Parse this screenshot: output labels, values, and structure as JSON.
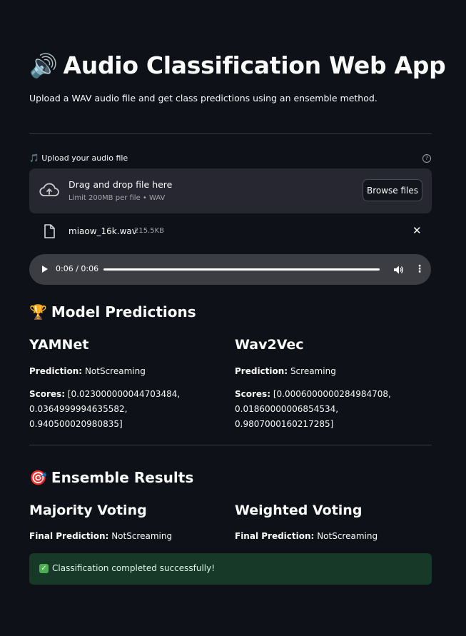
{
  "header": {
    "emoji": "🔊",
    "title": "Audio Classification Web App",
    "subtitle": "Upload a WAV audio file and get class predictions using an ensemble method."
  },
  "uploader": {
    "label": "🎵 Upload your audio file",
    "help_icon": "question-circle-icon",
    "drop_title": "Drag and drop file here",
    "limit_text": "Limit 200MB per file • WAV",
    "browse_label": "Browse files"
  },
  "uploaded_file": {
    "name": "miaow_16k.wav",
    "size": "215.5KB"
  },
  "audio_player": {
    "time": "0:06 / 0:06",
    "progress": 1.0
  },
  "predictions": {
    "heading": "Model Predictions",
    "emoji": "🏆",
    "models": [
      {
        "name": "YAMNet",
        "prediction_label": "Prediction:",
        "prediction": "NotScreaming",
        "scores_label": "Scores:",
        "scores": "[0.023000000044703484, 0.0364999994635582, 0.940500020980835]"
      },
      {
        "name": "Wav2Vec",
        "prediction_label": "Prediction:",
        "prediction": "Screaming",
        "scores_label": "Scores:",
        "scores": "[0.0006000000284984708, 0.01860000006854534, 0.9807000160217285]"
      }
    ]
  },
  "ensemble": {
    "heading": "Ensemble Results",
    "emoji": "🎯",
    "methods": [
      {
        "name": "Majority Voting",
        "label": "Final Prediction:",
        "value": "NotScreaming"
      },
      {
        "name": "Weighted Voting",
        "label": "Final Prediction:",
        "value": "NotScreaming"
      }
    ]
  },
  "status": {
    "message": "Classification completed successfully!",
    "color": "#173928"
  }
}
